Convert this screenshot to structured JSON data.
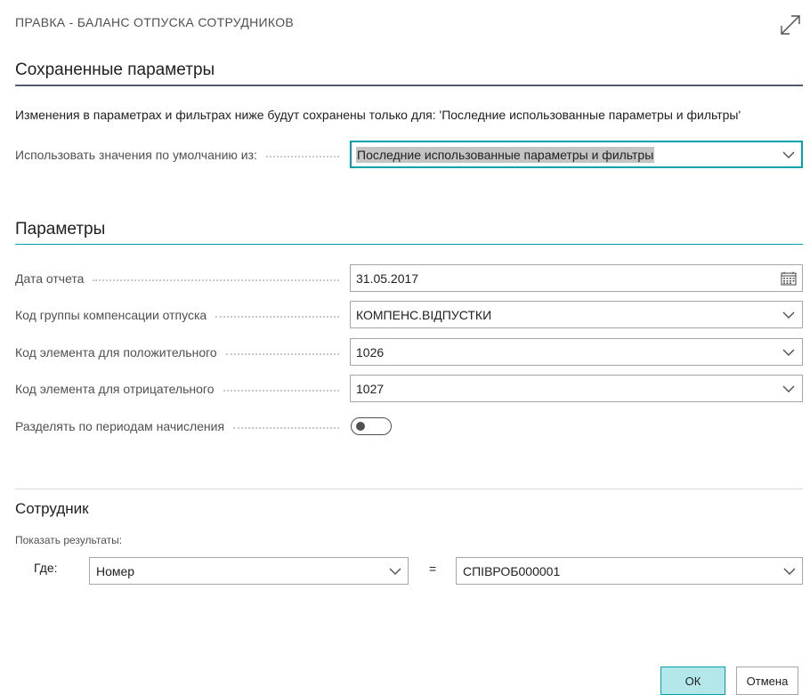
{
  "dialog": {
    "title": "ПРАВКА - БАЛАНС ОТПУСКА СОТРУДНИКОВ"
  },
  "saved_params": {
    "heading": "Сохраненные параметры",
    "info": "Изменения в параметрах и фильтрах ниже будут сохранены только для: 'Последние использованные параметры и фильтры'",
    "defaults_label": "Использовать значения по умолчанию из:",
    "defaults_value": "Последние использованные параметры и фильтры"
  },
  "params": {
    "heading": "Параметры",
    "fields": [
      {
        "label": "Дата отчета",
        "value": "31.05.2017",
        "control": "date"
      },
      {
        "label": "Код группы компенсации отпуска",
        "value": "КОМПЕНС.ВІДПУСТКИ",
        "control": "dropdown"
      },
      {
        "label": "Код элемента для положительного",
        "value": "1026",
        "control": "dropdown"
      },
      {
        "label": "Код элемента для отрицательного",
        "value": "1027",
        "control": "dropdown"
      }
    ],
    "toggle": {
      "label": "Разделять по периодам начисления",
      "on": false
    }
  },
  "employee": {
    "heading": "Сотрудник",
    "show_results": "Показать результаты:",
    "where_label": "Где:",
    "field": "Номер",
    "operator": "=",
    "value": "СПІВРОБ000001"
  },
  "buttons": {
    "ok": "ОК",
    "cancel": "Отмена"
  },
  "colors": {
    "accent": "#00a2ad",
    "ok_bg": "#b3e7ea",
    "heading_rule": "#505c6d"
  }
}
